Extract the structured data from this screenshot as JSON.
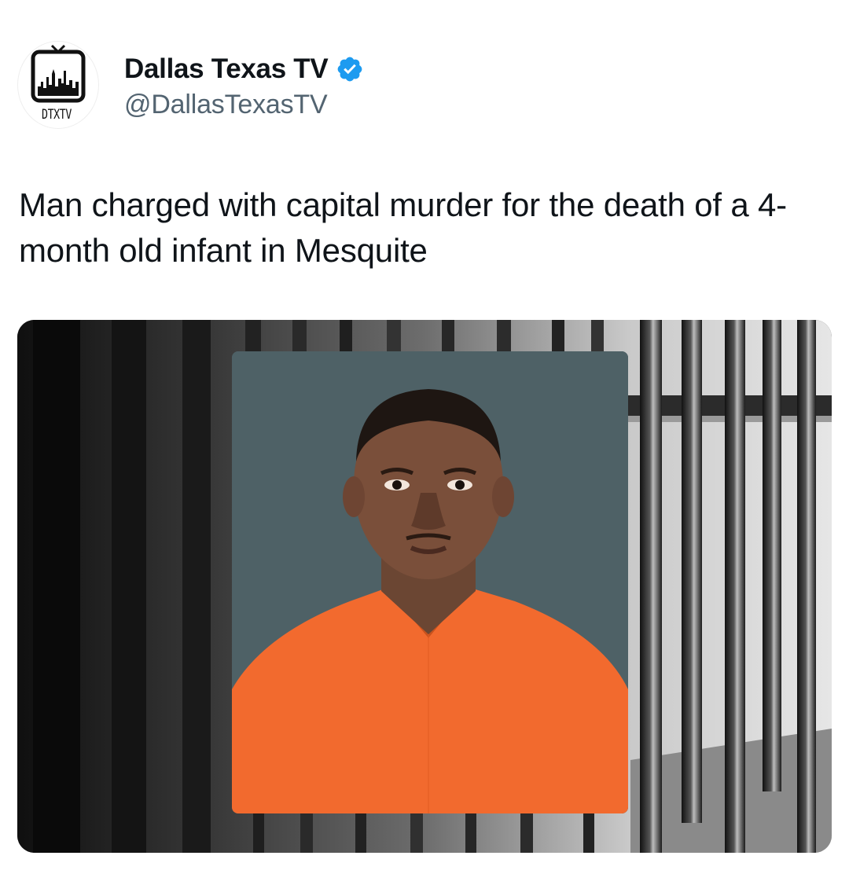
{
  "account": {
    "avatar_text": "DTXTV",
    "display_name": "Dallas Texas TV",
    "handle": "@DallasTexasTV",
    "verified": true,
    "verified_color": "#1d9bf0"
  },
  "post": {
    "text": "Man charged with capital murder for the death of a 4-month old infant in Mesquite"
  },
  "media": {
    "icons": [
      "tv-logo-icon",
      "verified-badge-icon"
    ],
    "mugshot_background_color": "#4e6166",
    "jumpsuit_color": "#f26a2e"
  }
}
